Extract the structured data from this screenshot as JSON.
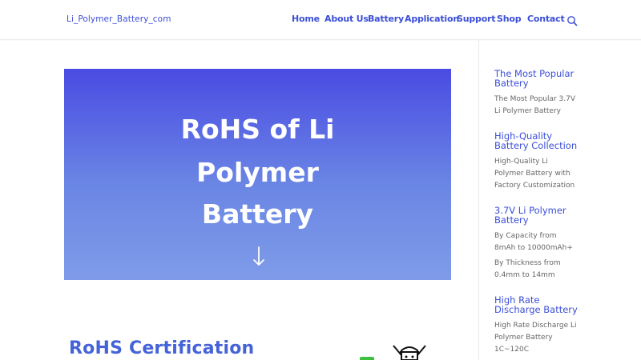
{
  "site": {
    "logo": "Li_Polymer_Battery_com"
  },
  "nav": {
    "items": [
      {
        "label": "Home"
      },
      {
        "label": "About Us"
      },
      {
        "label": "Battery"
      },
      {
        "label": "Application"
      },
      {
        "label": "Support"
      },
      {
        "label": "Shop"
      },
      {
        "label": "Contact"
      }
    ]
  },
  "hero": {
    "title_lines": [
      "RoHS of Li",
      "Polymer",
      "Battery"
    ]
  },
  "content": {
    "section_title": "RoHS Certification"
  },
  "sidebar": {
    "widgets": [
      {
        "title_lines": [
          "The Most Popular",
          "Battery"
        ],
        "links": [
          [
            "The Most Popular 3.7V",
            "Li Polymer Battery"
          ]
        ]
      },
      {
        "title_lines": [
          "High-Quality",
          "Battery Collection"
        ],
        "links": [
          [
            "High-Quality Li",
            "Polymer Battery with",
            "Factory Customization"
          ]
        ]
      },
      {
        "title_lines": [
          "3.7V Li Polymer",
          "Battery"
        ],
        "links": [
          [
            "By Capacity from",
            "8mAh to 10000mAh+"
          ],
          [
            "By Thickness from",
            "0.4mm to 14mm"
          ]
        ]
      },
      {
        "title_lines": [
          "High Rate",
          "Discharge Battery"
        ],
        "links": [
          [
            "High Rate Discharge Li",
            "Polymer Battery",
            "1C~120C"
          ]
        ]
      }
    ]
  },
  "colors": {
    "accent": "#3b4fd8",
    "hero_top": "#4a4be3",
    "hero_bottom": "#7f9be8",
    "section_title": "#4563d8"
  },
  "icons": {
    "search": "search-icon",
    "down": "arrow-down-icon"
  }
}
